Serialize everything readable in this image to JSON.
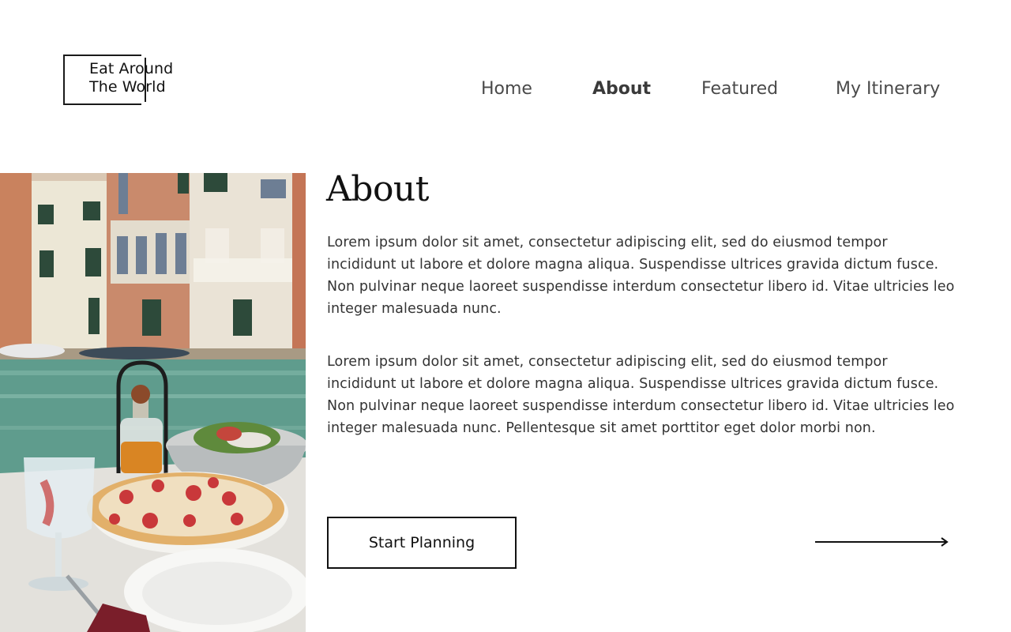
{
  "brand": {
    "line1": "Eat Around",
    "line2": "The World"
  },
  "nav": {
    "items": [
      {
        "label": "Home",
        "active": false
      },
      {
        "label": "About",
        "active": true
      },
      {
        "label": "Featured",
        "active": false
      },
      {
        "label": "My Itinerary",
        "active": false
      }
    ]
  },
  "main": {
    "heading": "About",
    "paragraphs": [
      "Lorem ipsum dolor sit amet, consectetur adipiscing elit, sed do eiusmod tempor incididunt ut labore et dolore magna aliqua. Suspendisse ultrices gravida dictum fusce. Non pulvinar neque laoreet suspendisse interdum consectetur libero id. Vitae ultricies leo integer malesuada nunc.",
      "Lorem ipsum dolor sit amet, consectetur adipiscing elit, sed do eiusmod tempor incididunt ut labore et dolore magna aliqua. Suspendisse ultrices gravida dictum fusce. Non pulvinar neque laoreet suspendisse interdum consectetur libero id. Vitae ultricies leo integer malesuada nunc. Pellentesque sit amet porttitor eget dolor morbi non."
    ],
    "cta_label": "Start Planning"
  },
  "icons": {
    "arrow": "arrow-right-icon"
  },
  "colors": {
    "text": "#333333",
    "heading": "#111111",
    "background": "#ffffff"
  }
}
